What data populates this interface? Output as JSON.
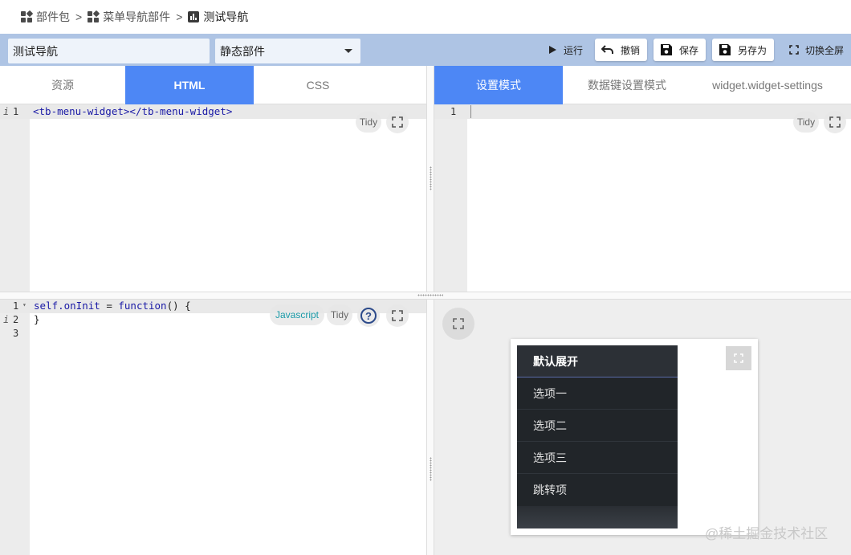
{
  "breadcrumb": {
    "items": [
      "部件包",
      "菜单导航部件",
      "测试导航"
    ],
    "separator": ">"
  },
  "toolbar": {
    "name_value": "测试导航",
    "type_value": "静态部件",
    "run_label": "运行",
    "undo_label": "撤销",
    "save_label": "保存",
    "save_as_label": "另存为",
    "fullscreen_label": "切换全屏"
  },
  "html_panel": {
    "tabs": [
      "资源",
      "HTML",
      "CSS"
    ],
    "active_tab": "HTML",
    "line_numbers": [
      "1"
    ],
    "code_line1_open": "<tb-menu-widget>",
    "code_line1_close": "</tb-menu-widget>",
    "tidy_label": "Tidy",
    "info_marker": "i"
  },
  "settings_panel": {
    "tabs": [
      "设置模式",
      "数据键设置模式",
      "widget.widget-settings"
    ],
    "active_tab": "设置模式",
    "line_numbers": [
      "1"
    ],
    "tidy_label": "Tidy"
  },
  "js_panel": {
    "line_numbers": [
      "1",
      "2",
      "3"
    ],
    "code_line1_a": "self.onInit",
    "code_line1_b": " = ",
    "code_line1_c": "function",
    "code_line1_d": "() {",
    "code_line2": "}",
    "lang_label": "Javascript",
    "tidy_label": "Tidy",
    "help_label": "?",
    "info_marker": "i"
  },
  "preview": {
    "menu_header": "默认展开",
    "menu_items": [
      "选项一",
      "选项二",
      "选项三",
      "跳转项"
    ]
  },
  "watermark": "@稀土掘金技术社区",
  "colors": {
    "accent": "#4d87f5",
    "toolbar_bg": "#aec4e4",
    "menu_bg": "#212529"
  }
}
